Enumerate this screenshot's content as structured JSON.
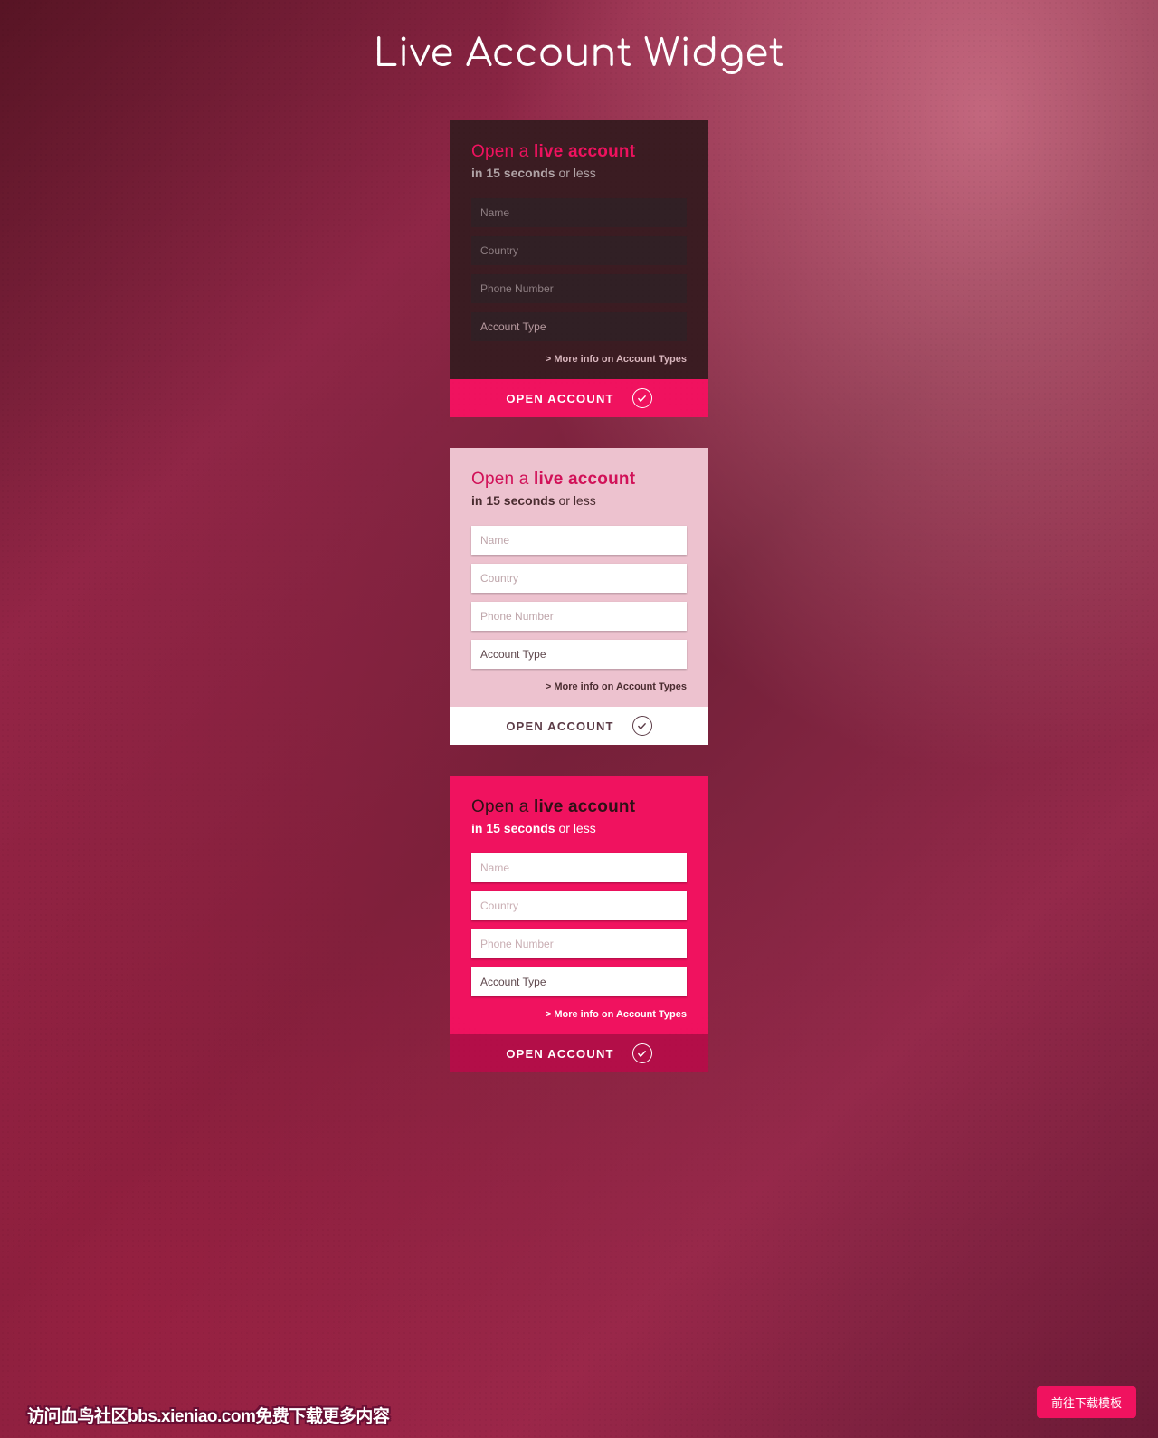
{
  "page_title": "Live Account Widget",
  "shared": {
    "title_prefix": "Open a ",
    "title_strong": "live account",
    "sub_strong": "in 15 seconds ",
    "sub_muted": "or less",
    "name_ph": "Name",
    "country_ph": "Country",
    "phone_ph": "Phone Number",
    "acct_type_label": "Account Type",
    "more_info": "> More info on Account Types",
    "cta_label": "OPEN ACCOUNT"
  },
  "variants": [
    "dark",
    "light",
    "pink"
  ],
  "download_pill": "前往下载模板",
  "watermark": "访问血鸟社区bbs.xieniao.com免费下载更多内容",
  "colors": {
    "accent": "#f0125f",
    "panel_dark": "#3b1c22",
    "panel_light": "#edc2cf",
    "cta_pink_dim": "#b30e48"
  }
}
